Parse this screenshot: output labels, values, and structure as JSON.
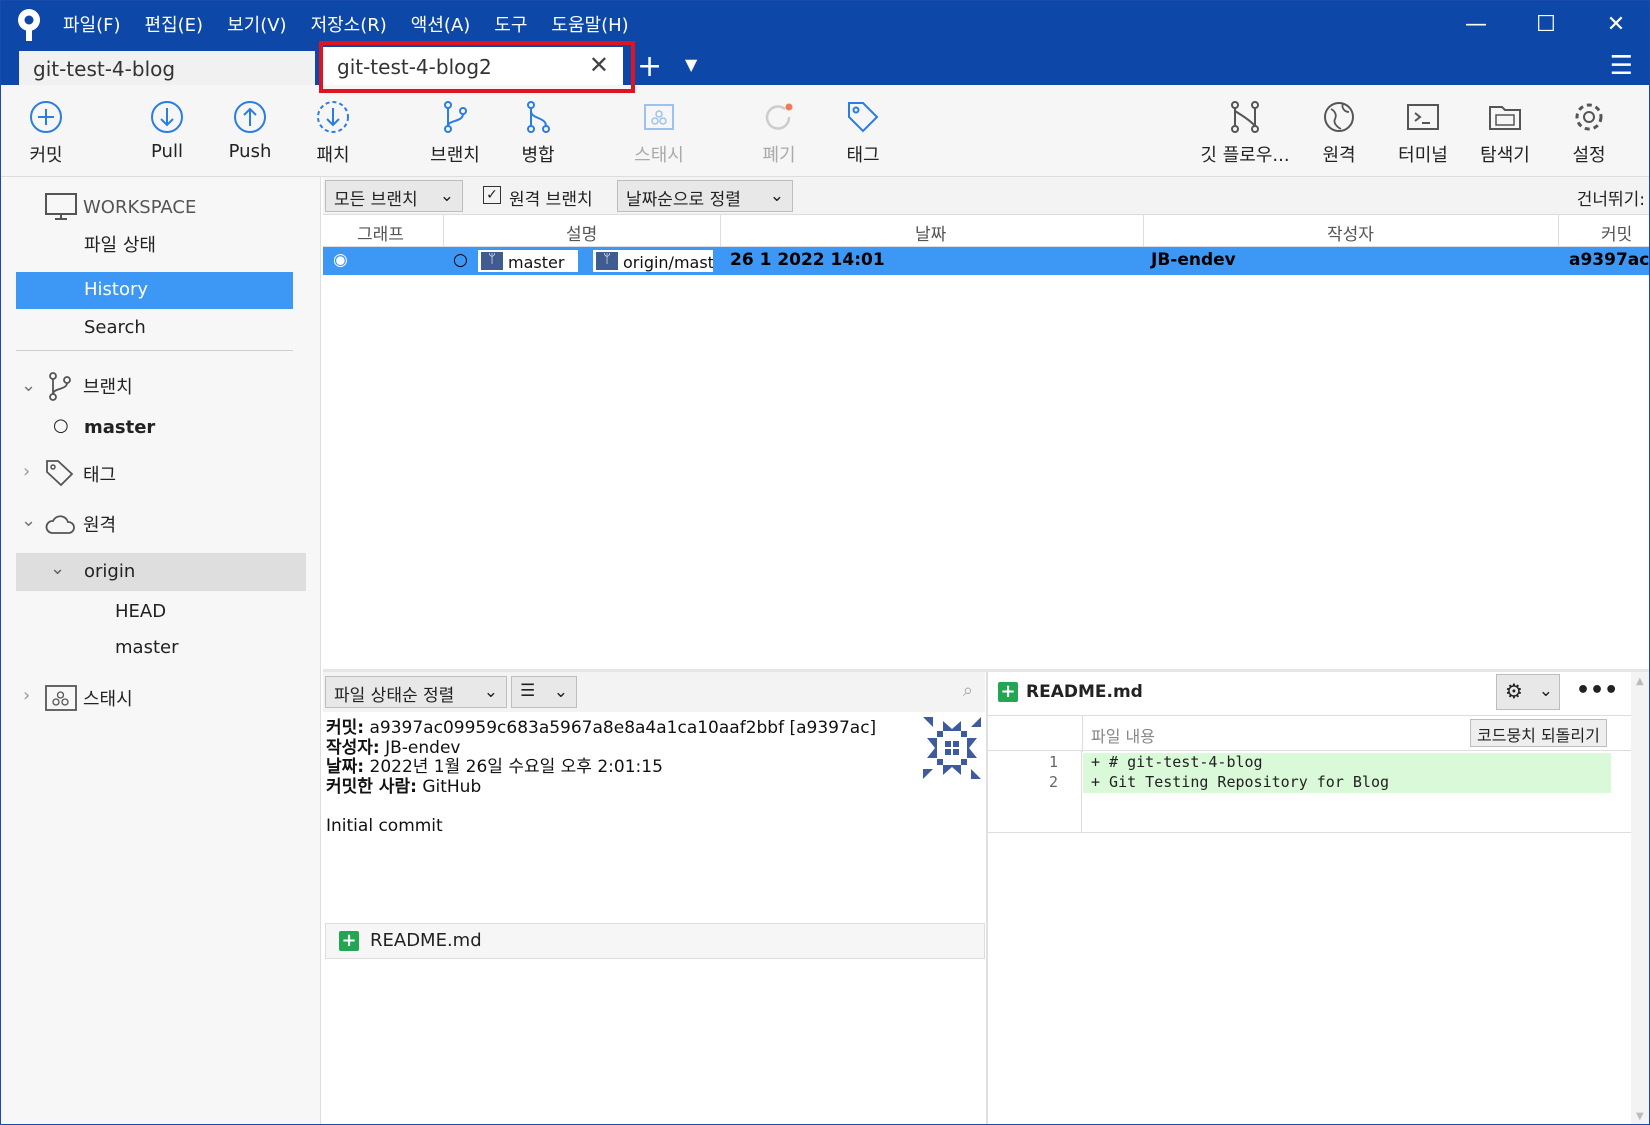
{
  "menu": [
    "파일(F)",
    "편집(E)",
    "보기(V)",
    "저장소(R)",
    "액션(A)",
    "도구",
    "도움말(H)"
  ],
  "window_controls": {
    "minimize": "—",
    "maximize": "☐",
    "close": "✕"
  },
  "tabs": [
    {
      "label": "git-test-4-blog",
      "active": false
    },
    {
      "label": "git-test-4-blog2",
      "active": true
    }
  ],
  "toolbar": {
    "commit": "커밋",
    "pull": "Pull",
    "push": "Push",
    "fetch": "패치",
    "branch": "브랜치",
    "merge": "병합",
    "stash": "스태시",
    "discard": "폐기",
    "tag": "태그",
    "git_flow": "깃 플로우...",
    "remote": "원격",
    "terminal": "터미널",
    "explorer": "탐색기",
    "settings": "설정"
  },
  "sidebar": {
    "workspace": "WORKSPACE",
    "file_status": "파일 상태",
    "history": "History",
    "search": "Search",
    "branches": "브랜치",
    "branch_master": "master",
    "tags": "태그",
    "remotes": "원격",
    "origin": "origin",
    "origin_head": "HEAD",
    "origin_master": "master",
    "stashes": "스태시"
  },
  "filter": {
    "all_branches": "모든 브랜치",
    "remote_branches": "원격 브랜치",
    "sort": "날짜순으로 정렬",
    "jump": "건너뛰기:"
  },
  "columns": {
    "graph": "그래프",
    "desc": "설명",
    "date": "날짜",
    "author": "작성자",
    "commit": "커밋"
  },
  "commits": [
    {
      "branch": "master",
      "remote": "origin/mast",
      "date": "26 1 2022 14:01",
      "author": "JB-endev",
      "hash": "a9397ac"
    }
  ],
  "file_sort": "파일 상태순 정렬",
  "commit_detail": {
    "commit_label": "커밋:",
    "commit_value": "a9397ac09959c683a5967a8e8a4a1ca10aaf2bbf [a9397ac]",
    "author_label": "작성자:",
    "author_value": "JB-endev",
    "date_label": "날짜:",
    "date_value": "2022년 1월 26일 수요일 오후 2:01:15",
    "committer_label": "커밋한 사람:",
    "committer_value": "GitHub",
    "message": "Initial commit"
  },
  "changed_file": "README.md",
  "diff": {
    "file": "README.md",
    "content_label": "파일 내용",
    "revert_button": "코드뭉치 되돌리기",
    "lines": [
      {
        "no": "1",
        "text": "+ # git-test-4-blog"
      },
      {
        "no": "2",
        "text": "+ Git Testing Repository for Blog"
      }
    ]
  },
  "colors": {
    "titlebar": "#0d47a8",
    "selection": "#3d97f4",
    "highlight_box": "#e0141e",
    "added": "#22a652"
  }
}
